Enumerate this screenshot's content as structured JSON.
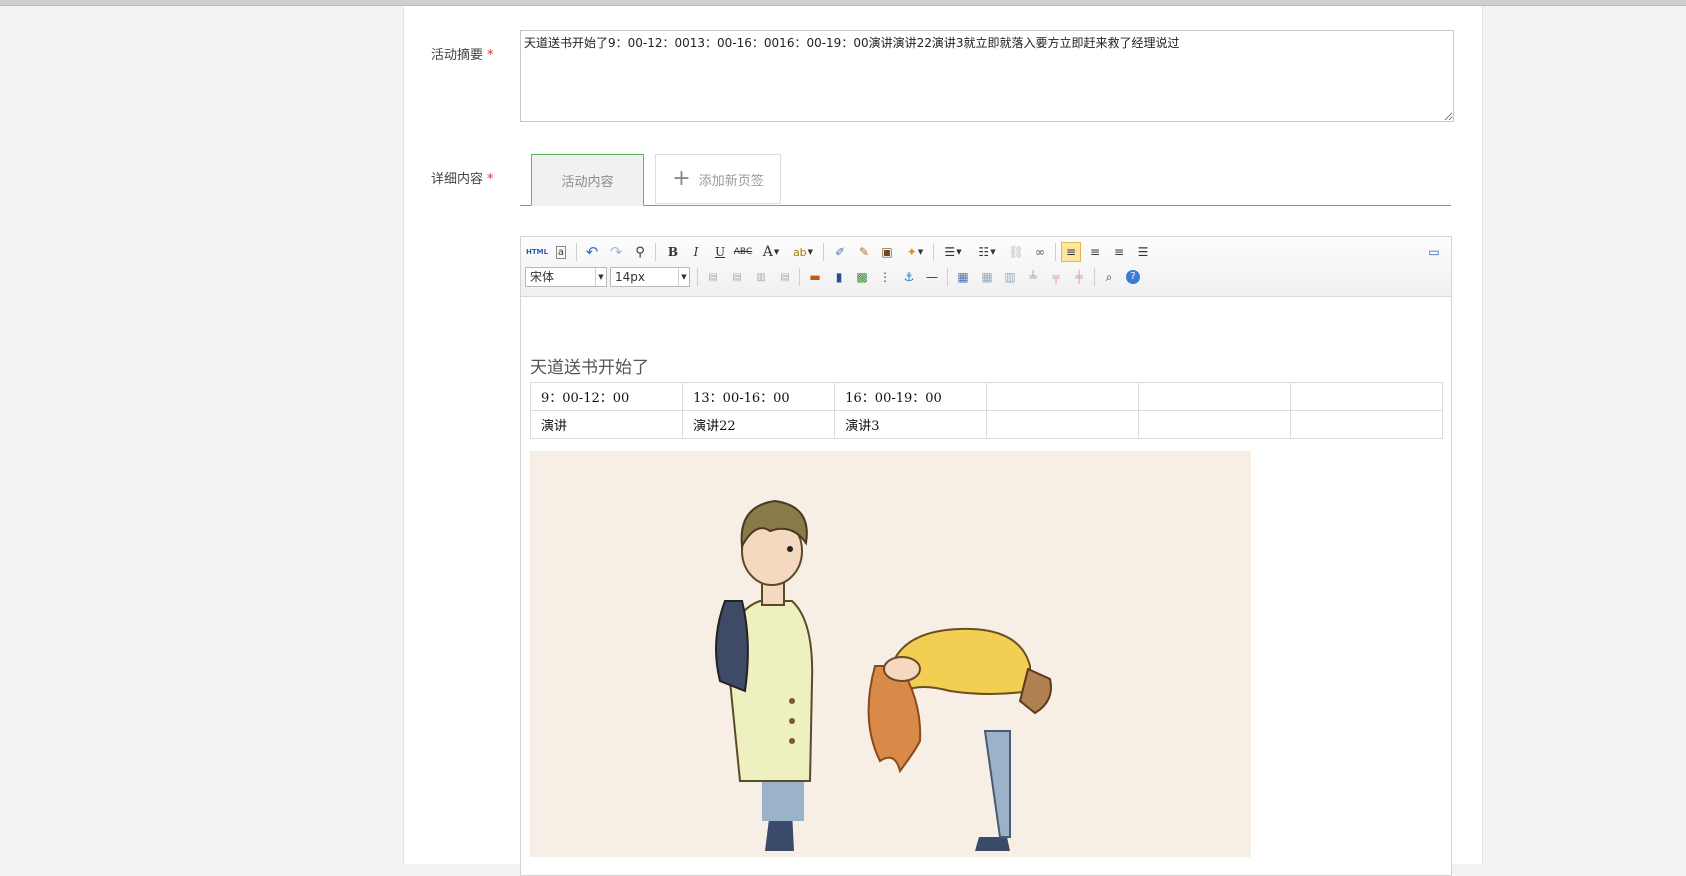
{
  "form": {
    "summary": {
      "label": "活动摘要",
      "required_mark": "*",
      "value": "天道送书开始了9：00-12：0013：00-16：0016：00-19：00演讲演讲22演讲3就立即就落入要方立即赶来救了经理说过"
    },
    "details": {
      "label": "详细内容",
      "required_mark": "*",
      "tabs": [
        {
          "label": "活动内容",
          "active": true
        }
      ],
      "add_tab_label": "添加新页签"
    }
  },
  "editor": {
    "toolbar": {
      "row1": [
        "html-source-icon",
        "text-a-icon",
        "undo-icon",
        "redo-icon",
        "find-icon",
        "bold-icon",
        "italic-icon",
        "underline-icon",
        "strikethrough-icon",
        "font-color-icon",
        "highlight-icon",
        "eraser-icon",
        "format-brush-icon",
        "paste-icon",
        "magic-wand-icon",
        "bullet-list-icon",
        "numbered-list-icon",
        "unlink-icon",
        "link-icon",
        "align-left-icon",
        "align-center-icon",
        "align-right-icon",
        "align-justify-icon",
        "fullscreen-icon"
      ],
      "row2": [
        "img-left-icon",
        "img-inline-icon",
        "img-right-icon",
        "img-center-icon",
        "image-icon",
        "video-icon",
        "map-icon",
        "column-icon",
        "anchor-icon",
        "horizontal-rule-icon",
        "table-icon",
        "row-icon",
        "column-insert-icon",
        "merge-icon",
        "split-icon",
        "delete-table-icon",
        "preview-icon",
        "help-icon"
      ],
      "font_family": "宋体",
      "font_size": "14px",
      "active_align": "left"
    },
    "content": {
      "heading": "天道送书开始了",
      "table": [
        [
          "9：00-12：00",
          "13：00-16：00",
          "16：00-19：00",
          "",
          "",
          ""
        ],
        [
          "演讲",
          "演讲22",
          "演讲3",
          "",
          "",
          ""
        ]
      ],
      "colors": {
        "background": "#f7efe6",
        "coat": "#eef0c0",
        "sweater": "#f2cf52",
        "hair": "#d98a48",
        "jeans": "#9bb3c9"
      }
    }
  }
}
